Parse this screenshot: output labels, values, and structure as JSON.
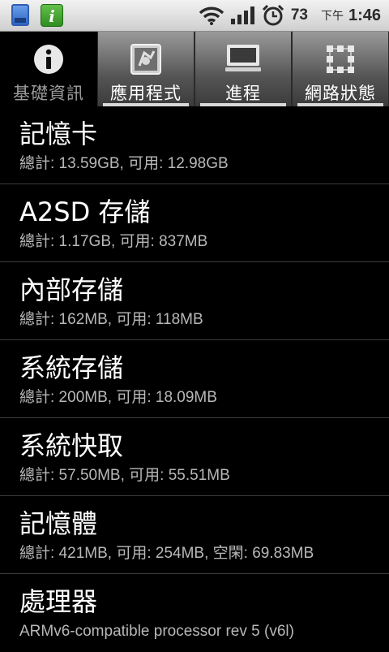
{
  "status_bar": {
    "battery_level": "73",
    "ampm": "下午",
    "time": "1:46",
    "icons": [
      "phone-icon",
      "info-app-icon",
      "wifi-icon",
      "signal-icon",
      "alarm-icon"
    ]
  },
  "tabs": [
    {
      "label": "基礎資訊",
      "icon": "info-icon",
      "active": true
    },
    {
      "label": "應用程式",
      "icon": "apps-icon",
      "active": false
    },
    {
      "label": "進程",
      "icon": "monitor-icon",
      "active": false
    },
    {
      "label": "網路狀態",
      "icon": "network-icon",
      "active": false
    }
  ],
  "items": [
    {
      "title": "記憶卡",
      "detail": "總計: 13.59GB, 可用: 12.98GB"
    },
    {
      "title": "A2SD 存儲",
      "detail": "總計: 1.17GB, 可用: 837MB"
    },
    {
      "title": "內部存儲",
      "detail": "總計: 162MB, 可用: 118MB"
    },
    {
      "title": "系統存儲",
      "detail": "總計: 200MB, 可用: 18.09MB"
    },
    {
      "title": "系統快取",
      "detail": "總計: 57.50MB, 可用: 55.51MB"
    },
    {
      "title": "記憶體",
      "detail": "總計: 421MB, 可用: 254MB, 空閑: 69.83MB"
    },
    {
      "title": "處理器",
      "detail": "ARMv6-compatible processor rev 5 (v6l)"
    }
  ]
}
